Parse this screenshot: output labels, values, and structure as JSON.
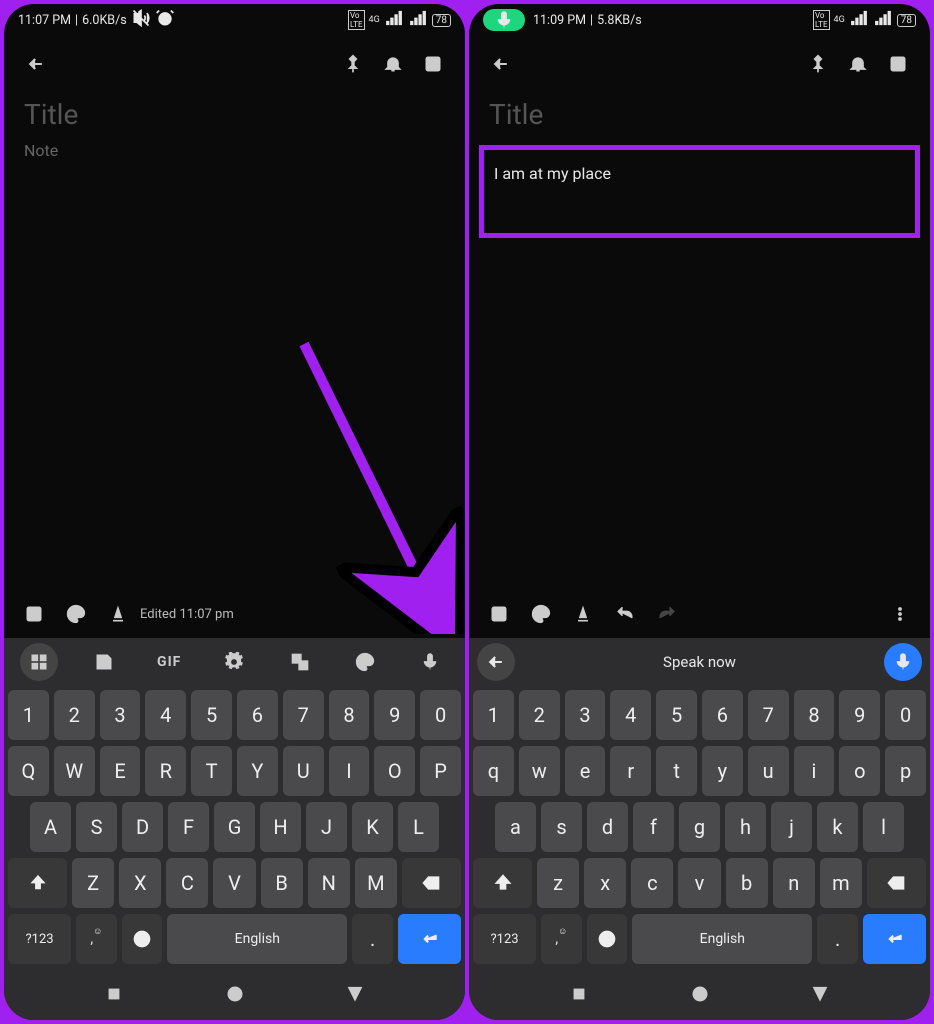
{
  "left": {
    "status": {
      "time": "11:07 PM",
      "speed": "6.0KB/s",
      "lte": "LTE",
      "net": "4G",
      "battery": "78"
    },
    "title_placeholder": "Title",
    "note_placeholder": "Note",
    "edited": "Edited 11:07 pm",
    "kb_top": {
      "gif": "GIF"
    },
    "rows": {
      "num": [
        "1",
        "2",
        "3",
        "4",
        "5",
        "6",
        "7",
        "8",
        "9",
        "0"
      ],
      "r1": [
        "Q",
        "W",
        "E",
        "R",
        "T",
        "Y",
        "U",
        "I",
        "O",
        "P"
      ],
      "r2": [
        "A",
        "S",
        "D",
        "F",
        "G",
        "H",
        "J",
        "K",
        "L"
      ],
      "r3": [
        "Z",
        "X",
        "C",
        "V",
        "B",
        "N",
        "M"
      ]
    },
    "bottom": {
      "sym": "?123",
      "space": "English",
      "dot": "."
    }
  },
  "right": {
    "status": {
      "time": "11:09 PM",
      "speed": "5.8KB/s",
      "lte": "LTE",
      "net": "4G",
      "battery": "78"
    },
    "title_placeholder": "Title",
    "note_text": "I am at my place",
    "speak": "Speak now",
    "rows": {
      "num": [
        "1",
        "2",
        "3",
        "4",
        "5",
        "6",
        "7",
        "8",
        "9",
        "0"
      ],
      "r1": [
        "q",
        "w",
        "e",
        "r",
        "t",
        "y",
        "u",
        "i",
        "o",
        "p"
      ],
      "r2": [
        "a",
        "s",
        "d",
        "f",
        "g",
        "h",
        "j",
        "k",
        "l"
      ],
      "r3": [
        "z",
        "x",
        "c",
        "v",
        "b",
        "n",
        "m"
      ]
    },
    "bottom": {
      "sym": "?123",
      "space": "English",
      "dot": "."
    }
  }
}
